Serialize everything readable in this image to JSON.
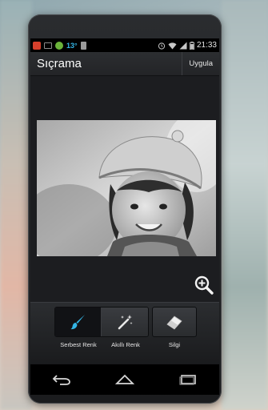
{
  "status_bar": {
    "temperature": "13°",
    "time": "21:33"
  },
  "action_bar": {
    "title": "Sıçrama",
    "apply_label": "Uygula"
  },
  "tools": {
    "free_color_label": "Serbest Renk",
    "smart_color_label": "Akıllı Renk",
    "eraser_label": "Silgi"
  },
  "colors": {
    "accent": "#33b5e5",
    "action_bar": "#2c2e31",
    "screen_bg": "#1c1d20"
  }
}
